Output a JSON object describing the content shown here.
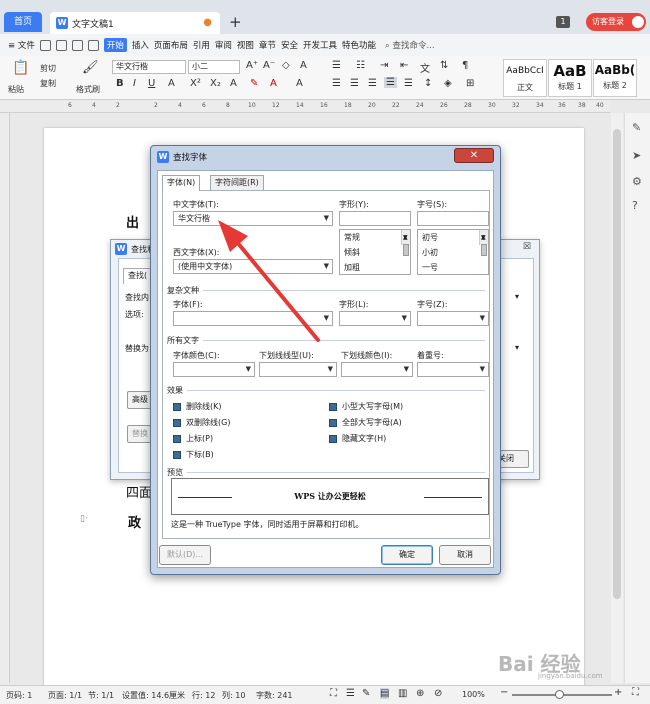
{
  "tabs": {
    "home": "首页",
    "doc": "文字文稿1",
    "new_tab": "+"
  },
  "header": {
    "page_badge": "1",
    "guest_login": "访客登录"
  },
  "menu": {
    "file": "≡ 文件",
    "items": [
      "开始",
      "插入",
      "页面布局",
      "引用",
      "审阅",
      "视图",
      "章节",
      "安全",
      "开发工具",
      "特色功能"
    ],
    "search": "查找命令..."
  },
  "ribbon": {
    "paste": "粘贴",
    "cut": "剪切",
    "copy": "复制",
    "format_painter": "格式刷",
    "font_name": "华文行楷",
    "font_size": "小二",
    "styles": [
      {
        "preview": "AaBbCcI",
        "name": "正文"
      },
      {
        "preview": "AaB",
        "name": "标题 1"
      },
      {
        "preview": "AaBb(",
        "name": "标题 2"
      }
    ]
  },
  "ruler": {
    "ticks": [
      "6",
      "4",
      "2",
      "2",
      "4",
      "6",
      "8",
      "10",
      "12",
      "14",
      "16",
      "18",
      "20",
      "22",
      "24",
      "26",
      "28",
      "30",
      "32",
      "34",
      "36",
      "38",
      "40"
    ]
  },
  "document": {
    "line1": "出",
    "line2": "四面",
    "line3": "政"
  },
  "bg_dialog": {
    "title": "查找和",
    "tab": "查找(",
    "find_label": "查找内",
    "options_label": "选项:",
    "replace_label": "替换为",
    "advanced_btn": "高级",
    "format_btn": "替换",
    "close_btn": "关闭"
  },
  "dialog": {
    "title": "查找字体",
    "tabs": [
      "字体(N)",
      "字符间距(R)"
    ],
    "chinese_font_label": "中文字体(T):",
    "chinese_font_value": "华文行楷",
    "western_font_label": "西文字体(X):",
    "western_font_value": "(使用中文字体)",
    "style_label": "字形(Y):",
    "style_options": [
      "常规",
      "倾斜",
      "加粗"
    ],
    "size_label": "字号(S):",
    "size_options": [
      "初号",
      "小初",
      "一号"
    ],
    "complex_section": "复杂文种",
    "complex_font_label": "字体(F):",
    "complex_style_label": "字形(L):",
    "complex_size_label": "字号(Z):",
    "all_text_section": "所有文字",
    "font_color_label": "字体颜色(C):",
    "underline_style_label": "下划线线型(U):",
    "underline_color_label": "下划线颜色(I):",
    "emphasis_label": "着重号:",
    "effects_section": "效果",
    "effects": [
      "删除线(K)",
      "双删除线(G)",
      "上标(P)",
      "下标(B)",
      "小型大写字母(M)",
      "全部大写字母(A)",
      "隐藏文字(H)"
    ],
    "preview_section": "预览",
    "preview_text": "WPS 让办公更轻松",
    "preview_note": "这是一种 TrueType 字体，同时适用于屏幕和打印机。",
    "default_btn": "默认(D)...",
    "ok_btn": "确定",
    "cancel_btn": "取消"
  },
  "status": {
    "page": "页码: 1",
    "pages": "页面: 1/1",
    "section": "节: 1/1",
    "position": "设置值: 14.6厘米",
    "row": "行: 12",
    "col": "列: 10",
    "words": "字数: 241",
    "zoom": "100%"
  },
  "watermark": {
    "text": "Bai 经验",
    "sub": "jingyan.baidu.com"
  },
  "colors": {
    "accent": "#3b7cf5",
    "guest": "#e8453c",
    "arrow": "#e53935"
  }
}
